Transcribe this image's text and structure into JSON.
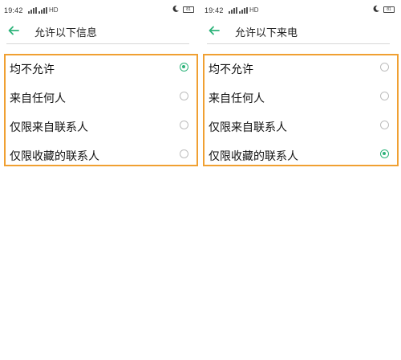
{
  "accent_color": "#2db37a",
  "highlight_color": "#f0a032",
  "left": {
    "status": {
      "time": "19:42",
      "network": "HD",
      "battery": "81"
    },
    "title": "允许以下信息",
    "options": [
      {
        "label": "均不允许",
        "checked": true
      },
      {
        "label": "来自任何人",
        "checked": false
      },
      {
        "label": "仅限来自联系人",
        "checked": false
      },
      {
        "label": "仅限收藏的联系人",
        "checked": false
      }
    ]
  },
  "right": {
    "status": {
      "time": "19:42",
      "network": "HD",
      "battery": "81"
    },
    "title": "允许以下来电",
    "options": [
      {
        "label": "均不允许",
        "checked": false
      },
      {
        "label": "来自任何人",
        "checked": false
      },
      {
        "label": "仅限来自联系人",
        "checked": false
      },
      {
        "label": "仅限收藏的联系人",
        "checked": true
      }
    ]
  }
}
